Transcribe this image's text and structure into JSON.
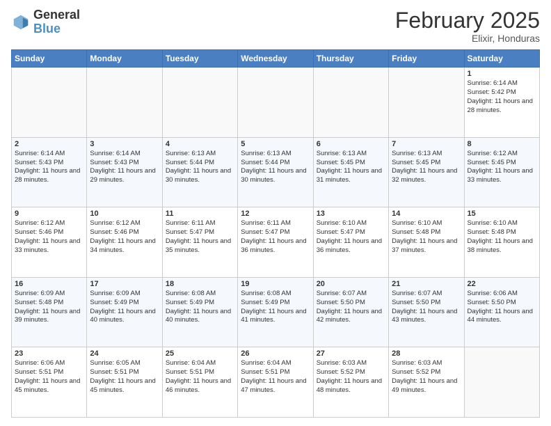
{
  "header": {
    "logo_general": "General",
    "logo_blue": "Blue",
    "month_title": "February 2025",
    "subtitle": "Elixir, Honduras"
  },
  "weekdays": [
    "Sunday",
    "Monday",
    "Tuesday",
    "Wednesday",
    "Thursday",
    "Friday",
    "Saturday"
  ],
  "weeks": [
    [
      {
        "day": "",
        "info": ""
      },
      {
        "day": "",
        "info": ""
      },
      {
        "day": "",
        "info": ""
      },
      {
        "day": "",
        "info": ""
      },
      {
        "day": "",
        "info": ""
      },
      {
        "day": "",
        "info": ""
      },
      {
        "day": "1",
        "info": "Sunrise: 6:14 AM\nSunset: 5:42 PM\nDaylight: 11 hours and 28 minutes."
      }
    ],
    [
      {
        "day": "2",
        "info": "Sunrise: 6:14 AM\nSunset: 5:43 PM\nDaylight: 11 hours and 28 minutes."
      },
      {
        "day": "3",
        "info": "Sunrise: 6:14 AM\nSunset: 5:43 PM\nDaylight: 11 hours and 29 minutes."
      },
      {
        "day": "4",
        "info": "Sunrise: 6:13 AM\nSunset: 5:44 PM\nDaylight: 11 hours and 30 minutes."
      },
      {
        "day": "5",
        "info": "Sunrise: 6:13 AM\nSunset: 5:44 PM\nDaylight: 11 hours and 30 minutes."
      },
      {
        "day": "6",
        "info": "Sunrise: 6:13 AM\nSunset: 5:45 PM\nDaylight: 11 hours and 31 minutes."
      },
      {
        "day": "7",
        "info": "Sunrise: 6:13 AM\nSunset: 5:45 PM\nDaylight: 11 hours and 32 minutes."
      },
      {
        "day": "8",
        "info": "Sunrise: 6:12 AM\nSunset: 5:45 PM\nDaylight: 11 hours and 33 minutes."
      }
    ],
    [
      {
        "day": "9",
        "info": "Sunrise: 6:12 AM\nSunset: 5:46 PM\nDaylight: 11 hours and 33 minutes."
      },
      {
        "day": "10",
        "info": "Sunrise: 6:12 AM\nSunset: 5:46 PM\nDaylight: 11 hours and 34 minutes."
      },
      {
        "day": "11",
        "info": "Sunrise: 6:11 AM\nSunset: 5:47 PM\nDaylight: 11 hours and 35 minutes."
      },
      {
        "day": "12",
        "info": "Sunrise: 6:11 AM\nSunset: 5:47 PM\nDaylight: 11 hours and 36 minutes."
      },
      {
        "day": "13",
        "info": "Sunrise: 6:10 AM\nSunset: 5:47 PM\nDaylight: 11 hours and 36 minutes."
      },
      {
        "day": "14",
        "info": "Sunrise: 6:10 AM\nSunset: 5:48 PM\nDaylight: 11 hours and 37 minutes."
      },
      {
        "day": "15",
        "info": "Sunrise: 6:10 AM\nSunset: 5:48 PM\nDaylight: 11 hours and 38 minutes."
      }
    ],
    [
      {
        "day": "16",
        "info": "Sunrise: 6:09 AM\nSunset: 5:48 PM\nDaylight: 11 hours and 39 minutes."
      },
      {
        "day": "17",
        "info": "Sunrise: 6:09 AM\nSunset: 5:49 PM\nDaylight: 11 hours and 40 minutes."
      },
      {
        "day": "18",
        "info": "Sunrise: 6:08 AM\nSunset: 5:49 PM\nDaylight: 11 hours and 40 minutes."
      },
      {
        "day": "19",
        "info": "Sunrise: 6:08 AM\nSunset: 5:49 PM\nDaylight: 11 hours and 41 minutes."
      },
      {
        "day": "20",
        "info": "Sunrise: 6:07 AM\nSunset: 5:50 PM\nDaylight: 11 hours and 42 minutes."
      },
      {
        "day": "21",
        "info": "Sunrise: 6:07 AM\nSunset: 5:50 PM\nDaylight: 11 hours and 43 minutes."
      },
      {
        "day": "22",
        "info": "Sunrise: 6:06 AM\nSunset: 5:50 PM\nDaylight: 11 hours and 44 minutes."
      }
    ],
    [
      {
        "day": "23",
        "info": "Sunrise: 6:06 AM\nSunset: 5:51 PM\nDaylight: 11 hours and 45 minutes."
      },
      {
        "day": "24",
        "info": "Sunrise: 6:05 AM\nSunset: 5:51 PM\nDaylight: 11 hours and 45 minutes."
      },
      {
        "day": "25",
        "info": "Sunrise: 6:04 AM\nSunset: 5:51 PM\nDaylight: 11 hours and 46 minutes."
      },
      {
        "day": "26",
        "info": "Sunrise: 6:04 AM\nSunset: 5:51 PM\nDaylight: 11 hours and 47 minutes."
      },
      {
        "day": "27",
        "info": "Sunrise: 6:03 AM\nSunset: 5:52 PM\nDaylight: 11 hours and 48 minutes."
      },
      {
        "day": "28",
        "info": "Sunrise: 6:03 AM\nSunset: 5:52 PM\nDaylight: 11 hours and 49 minutes."
      },
      {
        "day": "",
        "info": ""
      }
    ]
  ]
}
